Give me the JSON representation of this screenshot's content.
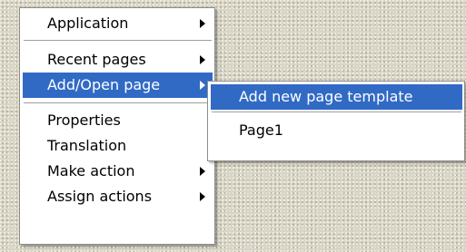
{
  "context_menu": {
    "items": [
      {
        "label": "Application",
        "has_submenu": true
      },
      {
        "label": "Recent pages",
        "has_submenu": true
      },
      {
        "label": "Add/Open page",
        "has_submenu": true,
        "highlighted": true
      },
      {
        "label": "Properties",
        "has_submenu": false
      },
      {
        "label": "Translation",
        "has_submenu": false
      },
      {
        "label": "Make action",
        "has_submenu": true
      },
      {
        "label": "Assign actions",
        "has_submenu": true
      }
    ]
  },
  "submenu": {
    "items": [
      {
        "label": "Add new page template",
        "highlighted": true
      },
      {
        "label": "Page1",
        "highlighted": false
      }
    ]
  },
  "colors": {
    "highlight": "#316ac5",
    "menu_background": "#ffffff",
    "desktop_background": "#d9d5c4"
  },
  "icons": {
    "submenu_arrow": "chevron-right-icon"
  }
}
